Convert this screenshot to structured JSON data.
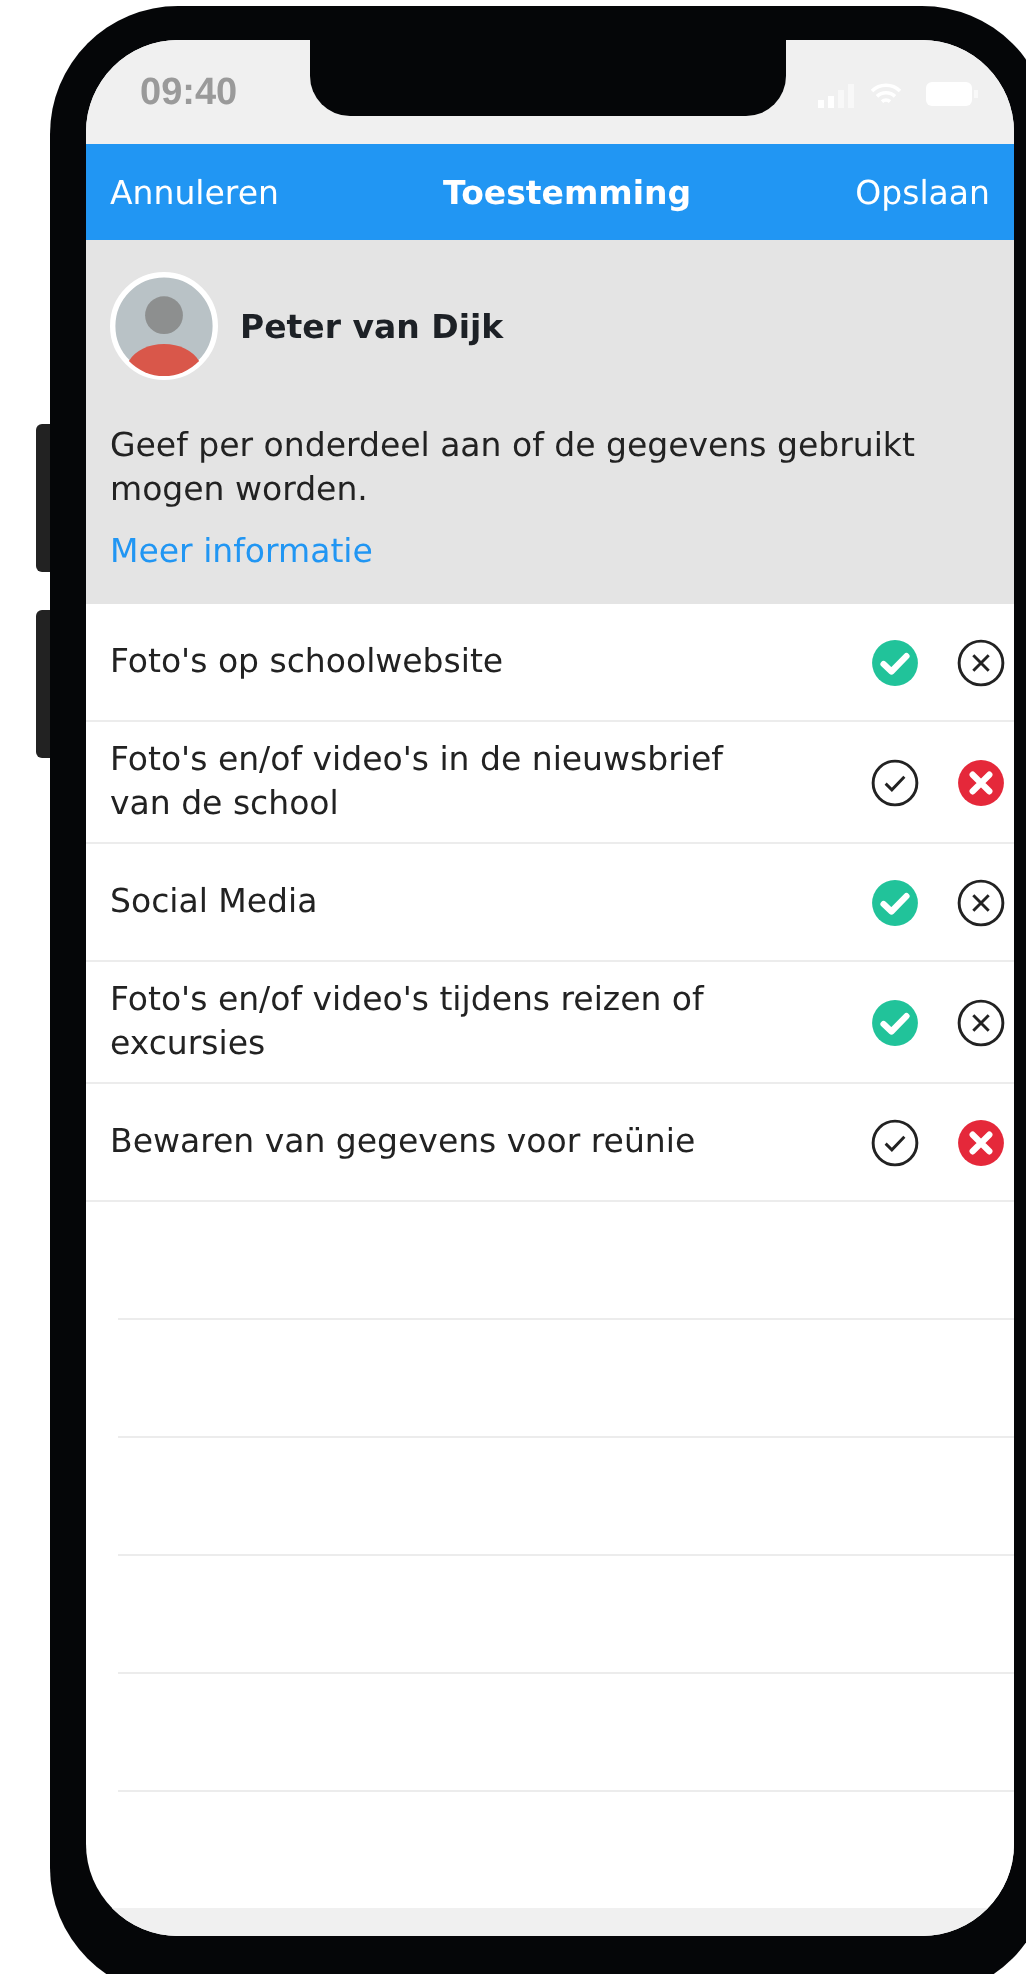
{
  "status_bar": {
    "time": "09:40"
  },
  "nav": {
    "cancel": "Annuleren",
    "title": "Toestemming",
    "save": "Opslaan"
  },
  "profile": {
    "name": "Peter van Dijk"
  },
  "intro": {
    "text": "Geef per onderdeel aan of de gegevens gebruikt mogen worden.",
    "link": "Meer informatie"
  },
  "items": [
    {
      "label": "Foto's op schoolwebsite",
      "allowed": true
    },
    {
      "label": "Foto's en/of video's in de nieuwsbrief van de school",
      "allowed": false
    },
    {
      "label": "Social Media",
      "allowed": true
    },
    {
      "label": "Foto's en/of video's tijdens reizen of excursies",
      "allowed": true
    },
    {
      "label": "Bewaren van gegevens voor reünie",
      "allowed": false
    }
  ]
}
